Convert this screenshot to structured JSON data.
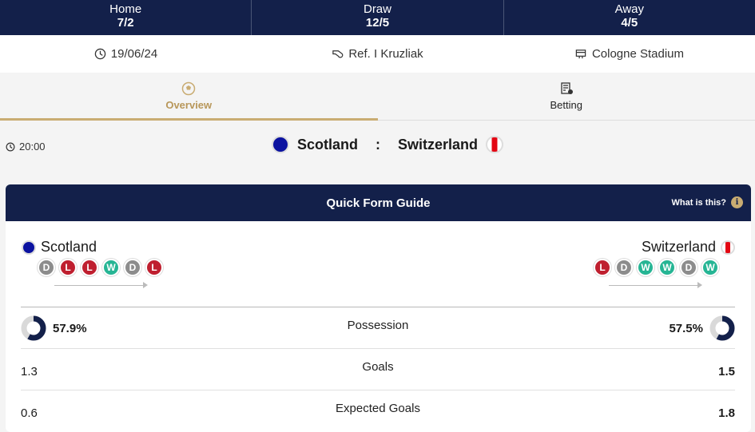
{
  "odds": {
    "home_label": "Home",
    "home_value": "7/2",
    "draw_label": "Draw",
    "draw_value": "12/5",
    "away_label": "Away",
    "away_value": "4/5"
  },
  "info": {
    "date": "19/06/24",
    "referee": "Ref. I Kruzliak",
    "venue": "Cologne Stadium"
  },
  "tabs": [
    {
      "label": "Overview",
      "active": true
    },
    {
      "label": "Betting",
      "active": false
    }
  ],
  "match": {
    "time": "20:00",
    "home_team": "Scotland",
    "separator": ":",
    "away_team": "Switzerland"
  },
  "form_guide": {
    "title": "Quick Form Guide",
    "help_text": "What is this?",
    "home": {
      "name": "Scotland",
      "form": [
        "D",
        "L",
        "L",
        "W",
        "D",
        "L"
      ]
    },
    "away": {
      "name": "Switzerland",
      "form": [
        "L",
        "D",
        "W",
        "W",
        "D",
        "W"
      ]
    }
  },
  "stats": [
    {
      "label": "Possession",
      "home": "57.9%",
      "away": "57.5%",
      "home_fraction": 0.579,
      "away_fraction": 0.575
    },
    {
      "label": "Goals",
      "home": "1.3",
      "away": "1.5"
    },
    {
      "label": "Expected Goals",
      "home": "0.6",
      "away": "1.8"
    }
  ],
  "colors": {
    "navy": "#13204a",
    "gold": "#c9ac72",
    "win": "#26b594",
    "draw": "#8c8c8c",
    "loss": "#bf1f2f",
    "scotland": "#0b12a0",
    "switzerland": "#e30613"
  }
}
